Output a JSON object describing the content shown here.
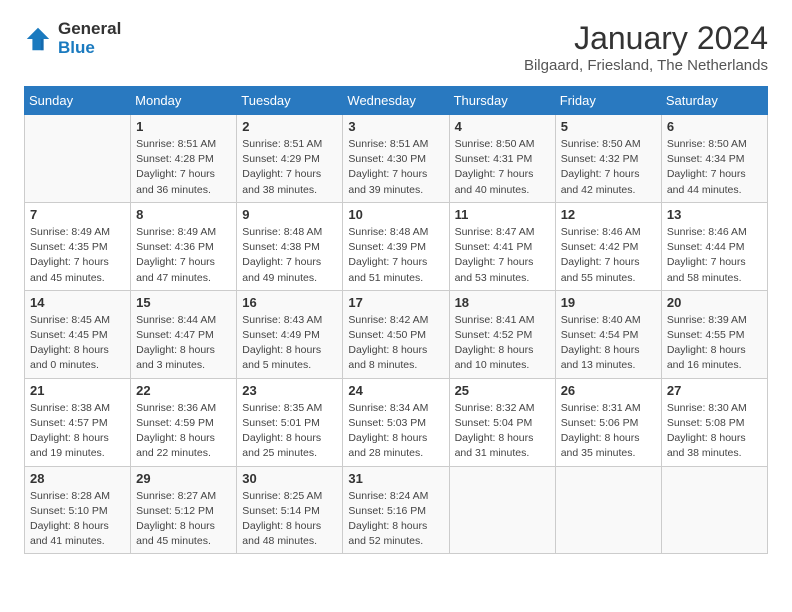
{
  "header": {
    "logo_general": "General",
    "logo_blue": "Blue",
    "title": "January 2024",
    "subtitle": "Bilgaard, Friesland, The Netherlands"
  },
  "calendar": {
    "days_of_week": [
      "Sunday",
      "Monday",
      "Tuesday",
      "Wednesday",
      "Thursday",
      "Friday",
      "Saturday"
    ],
    "weeks": [
      [
        {
          "day": "",
          "content": ""
        },
        {
          "day": "1",
          "content": "Sunrise: 8:51 AM\nSunset: 4:28 PM\nDaylight: 7 hours\nand 36 minutes."
        },
        {
          "day": "2",
          "content": "Sunrise: 8:51 AM\nSunset: 4:29 PM\nDaylight: 7 hours\nand 38 minutes."
        },
        {
          "day": "3",
          "content": "Sunrise: 8:51 AM\nSunset: 4:30 PM\nDaylight: 7 hours\nand 39 minutes."
        },
        {
          "day": "4",
          "content": "Sunrise: 8:50 AM\nSunset: 4:31 PM\nDaylight: 7 hours\nand 40 minutes."
        },
        {
          "day": "5",
          "content": "Sunrise: 8:50 AM\nSunset: 4:32 PM\nDaylight: 7 hours\nand 42 minutes."
        },
        {
          "day": "6",
          "content": "Sunrise: 8:50 AM\nSunset: 4:34 PM\nDaylight: 7 hours\nand 44 minutes."
        }
      ],
      [
        {
          "day": "7",
          "content": "Sunrise: 8:49 AM\nSunset: 4:35 PM\nDaylight: 7 hours\nand 45 minutes."
        },
        {
          "day": "8",
          "content": "Sunrise: 8:49 AM\nSunset: 4:36 PM\nDaylight: 7 hours\nand 47 minutes."
        },
        {
          "day": "9",
          "content": "Sunrise: 8:48 AM\nSunset: 4:38 PM\nDaylight: 7 hours\nand 49 minutes."
        },
        {
          "day": "10",
          "content": "Sunrise: 8:48 AM\nSunset: 4:39 PM\nDaylight: 7 hours\nand 51 minutes."
        },
        {
          "day": "11",
          "content": "Sunrise: 8:47 AM\nSunset: 4:41 PM\nDaylight: 7 hours\nand 53 minutes."
        },
        {
          "day": "12",
          "content": "Sunrise: 8:46 AM\nSunset: 4:42 PM\nDaylight: 7 hours\nand 55 minutes."
        },
        {
          "day": "13",
          "content": "Sunrise: 8:46 AM\nSunset: 4:44 PM\nDaylight: 7 hours\nand 58 minutes."
        }
      ],
      [
        {
          "day": "14",
          "content": "Sunrise: 8:45 AM\nSunset: 4:45 PM\nDaylight: 8 hours\nand 0 minutes."
        },
        {
          "day": "15",
          "content": "Sunrise: 8:44 AM\nSunset: 4:47 PM\nDaylight: 8 hours\nand 3 minutes."
        },
        {
          "day": "16",
          "content": "Sunrise: 8:43 AM\nSunset: 4:49 PM\nDaylight: 8 hours\nand 5 minutes."
        },
        {
          "day": "17",
          "content": "Sunrise: 8:42 AM\nSunset: 4:50 PM\nDaylight: 8 hours\nand 8 minutes."
        },
        {
          "day": "18",
          "content": "Sunrise: 8:41 AM\nSunset: 4:52 PM\nDaylight: 8 hours\nand 10 minutes."
        },
        {
          "day": "19",
          "content": "Sunrise: 8:40 AM\nSunset: 4:54 PM\nDaylight: 8 hours\nand 13 minutes."
        },
        {
          "day": "20",
          "content": "Sunrise: 8:39 AM\nSunset: 4:55 PM\nDaylight: 8 hours\nand 16 minutes."
        }
      ],
      [
        {
          "day": "21",
          "content": "Sunrise: 8:38 AM\nSunset: 4:57 PM\nDaylight: 8 hours\nand 19 minutes."
        },
        {
          "day": "22",
          "content": "Sunrise: 8:36 AM\nSunset: 4:59 PM\nDaylight: 8 hours\nand 22 minutes."
        },
        {
          "day": "23",
          "content": "Sunrise: 8:35 AM\nSunset: 5:01 PM\nDaylight: 8 hours\nand 25 minutes."
        },
        {
          "day": "24",
          "content": "Sunrise: 8:34 AM\nSunset: 5:03 PM\nDaylight: 8 hours\nand 28 minutes."
        },
        {
          "day": "25",
          "content": "Sunrise: 8:32 AM\nSunset: 5:04 PM\nDaylight: 8 hours\nand 31 minutes."
        },
        {
          "day": "26",
          "content": "Sunrise: 8:31 AM\nSunset: 5:06 PM\nDaylight: 8 hours\nand 35 minutes."
        },
        {
          "day": "27",
          "content": "Sunrise: 8:30 AM\nSunset: 5:08 PM\nDaylight: 8 hours\nand 38 minutes."
        }
      ],
      [
        {
          "day": "28",
          "content": "Sunrise: 8:28 AM\nSunset: 5:10 PM\nDaylight: 8 hours\nand 41 minutes."
        },
        {
          "day": "29",
          "content": "Sunrise: 8:27 AM\nSunset: 5:12 PM\nDaylight: 8 hours\nand 45 minutes."
        },
        {
          "day": "30",
          "content": "Sunrise: 8:25 AM\nSunset: 5:14 PM\nDaylight: 8 hours\nand 48 minutes."
        },
        {
          "day": "31",
          "content": "Sunrise: 8:24 AM\nSunset: 5:16 PM\nDaylight: 8 hours\nand 52 minutes."
        },
        {
          "day": "",
          "content": ""
        },
        {
          "day": "",
          "content": ""
        },
        {
          "day": "",
          "content": ""
        }
      ]
    ]
  }
}
